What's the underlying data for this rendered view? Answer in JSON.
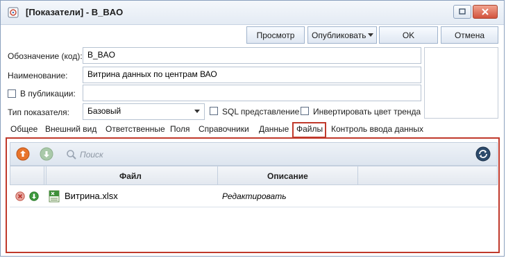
{
  "window": {
    "title": "[Показатели] - B_BAO"
  },
  "toolbar_buttons": {
    "preview": "Просмотр",
    "publish": "Опубликовать",
    "ok": "OK",
    "cancel": "Отмена"
  },
  "form": {
    "code_label": "Обозначение (код):",
    "code_value": "B_BAO",
    "name_label": "Наименование:",
    "name_value": "Витрина данных по центрам ВАО",
    "in_publication_label": "В публикации:",
    "in_publication_value": "",
    "type_label": "Тип показателя:",
    "type_value": "Базовый",
    "sql_view_label": "SQL представление",
    "invert_trend_label": "Инвертировать цвет тренда"
  },
  "tabs": [
    "Общее",
    "Внешний вид",
    "Ответственные",
    "Поля",
    "Справочники",
    "Данные",
    "Файлы",
    "Контроль ввода данных"
  ],
  "active_tab": "Файлы",
  "files_panel": {
    "search_placeholder": "Поиск",
    "columns": [
      "Файл",
      "Описание"
    ],
    "rows": [
      {
        "file": "Витрина.xlsx",
        "description": "Редактировать"
      }
    ]
  },
  "colors": {
    "highlight": "#c0392b",
    "upload": "#e8742c",
    "download": "#3f9a3f",
    "refresh": "#2c4a6b"
  }
}
